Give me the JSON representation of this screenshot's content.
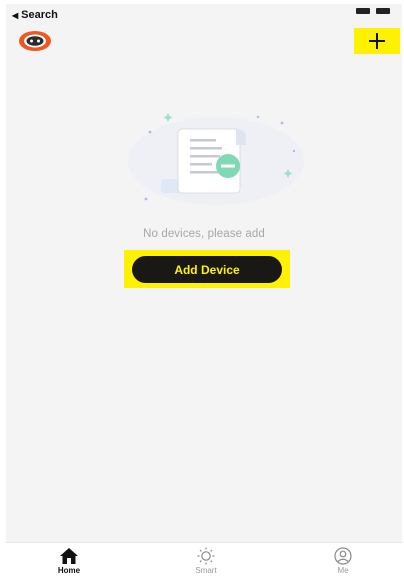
{
  "status_bar": {
    "back_label": "Search",
    "back_icon": "back-triangle-icon"
  },
  "header": {
    "avatar_icon": "robot-avatar-icon",
    "add_icon": "plus-icon"
  },
  "empty_state": {
    "illustration_icon": "empty-document-icon",
    "message": "No devices, please add",
    "button_label": "Add Device"
  },
  "tab_bar": {
    "items": [
      {
        "label": "Home",
        "icon": "home-icon",
        "active": true
      },
      {
        "label": "Smart",
        "icon": "sun-icon",
        "active": false
      },
      {
        "label": "Me",
        "icon": "profile-icon",
        "active": false
      }
    ]
  },
  "colors": {
    "accent_yellow": "#fff200",
    "button_dark": "#1a1814",
    "background": "#f4f4f5",
    "illustration_green": "#7fd8b6",
    "avatar_orange": "#f0561f"
  }
}
